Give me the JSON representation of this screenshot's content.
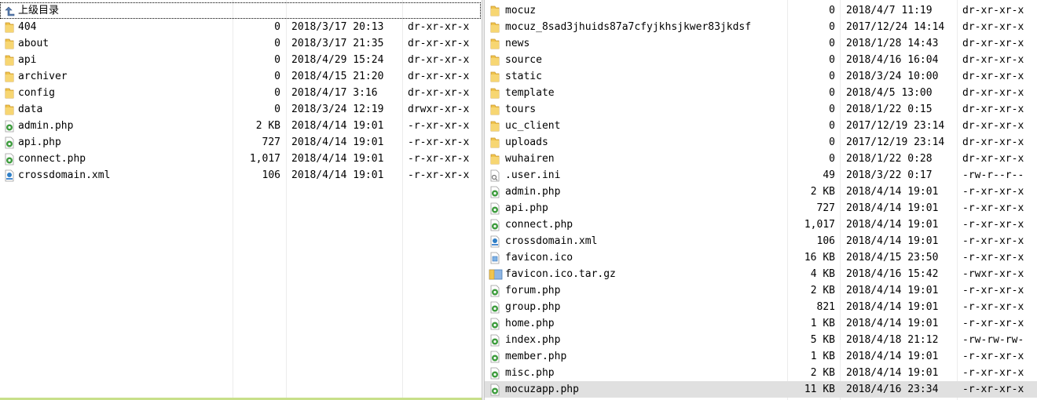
{
  "left_pane": {
    "rows": [
      {
        "name": "上级目录",
        "size": "",
        "date": "",
        "perm": "",
        "icon": "parent-dir-icon",
        "parent": true
      },
      {
        "name": "404",
        "size": "0",
        "date": "2018/3/17 20:13",
        "perm": "dr-xr-xr-x",
        "icon": "folder-icon"
      },
      {
        "name": "about",
        "size": "0",
        "date": "2018/3/17 21:35",
        "perm": "dr-xr-xr-x",
        "icon": "folder-icon"
      },
      {
        "name": "api",
        "size": "0",
        "date": "2018/4/29 15:24",
        "perm": "dr-xr-xr-x",
        "icon": "folder-icon"
      },
      {
        "name": "archiver",
        "size": "0",
        "date": "2018/4/15 21:20",
        "perm": "dr-xr-xr-x",
        "icon": "folder-icon"
      },
      {
        "name": "config",
        "size": "0",
        "date": "2018/4/17 3:16",
        "perm": "dr-xr-xr-x",
        "icon": "folder-icon"
      },
      {
        "name": "data",
        "size": "0",
        "date": "2018/3/24 12:19",
        "perm": "drwxr-xr-x",
        "icon": "folder-icon"
      },
      {
        "name": "admin.php",
        "size": "2 KB",
        "date": "2018/4/14 19:01",
        "perm": "-r-xr-xr-x",
        "icon": "php-file-icon"
      },
      {
        "name": "api.php",
        "size": "727",
        "date": "2018/4/14 19:01",
        "perm": "-r-xr-xr-x",
        "icon": "php-file-icon"
      },
      {
        "name": "connect.php",
        "size": "1,017",
        "date": "2018/4/14 19:01",
        "perm": "-r-xr-xr-x",
        "icon": "php-file-icon"
      },
      {
        "name": "crossdomain.xml",
        "size": "106",
        "date": "2018/4/14 19:01",
        "perm": "-r-xr-xr-x",
        "icon": "xml-file-icon"
      }
    ]
  },
  "right_pane": {
    "rows": [
      {
        "name": "mocuz",
        "size": "0",
        "date": "2018/4/7 11:19",
        "perm": "dr-xr-xr-x",
        "icon": "folder-icon"
      },
      {
        "name": "mocuz_8sad3jhuids87a7cfyjkhsjkwer83jkdsf",
        "size": "0",
        "date": "2017/12/24 14:14",
        "perm": "dr-xr-xr-x",
        "icon": "folder-icon"
      },
      {
        "name": "news",
        "size": "0",
        "date": "2018/1/28 14:43",
        "perm": "dr-xr-xr-x",
        "icon": "folder-icon"
      },
      {
        "name": "source",
        "size": "0",
        "date": "2018/4/16 16:04",
        "perm": "dr-xr-xr-x",
        "icon": "folder-icon"
      },
      {
        "name": "static",
        "size": "0",
        "date": "2018/3/24 10:00",
        "perm": "dr-xr-xr-x",
        "icon": "folder-icon"
      },
      {
        "name": "template",
        "size": "0",
        "date": "2018/4/5 13:00",
        "perm": "dr-xr-xr-x",
        "icon": "folder-icon"
      },
      {
        "name": "tours",
        "size": "0",
        "date": "2018/1/22 0:15",
        "perm": "dr-xr-xr-x",
        "icon": "folder-icon"
      },
      {
        "name": "uc_client",
        "size": "0",
        "date": "2017/12/19 23:14",
        "perm": "dr-xr-xr-x",
        "icon": "folder-icon"
      },
      {
        "name": "uploads",
        "size": "0",
        "date": "2017/12/19 23:14",
        "perm": "dr-xr-xr-x",
        "icon": "folder-icon"
      },
      {
        "name": "wuhairen",
        "size": "0",
        "date": "2018/1/22 0:28",
        "perm": "dr-xr-xr-x",
        "icon": "folder-icon"
      },
      {
        "name": ".user.ini",
        "size": "49",
        "date": "2018/3/22 0:17",
        "perm": "-rw-r--r--",
        "icon": "ini-file-icon"
      },
      {
        "name": "admin.php",
        "size": "2 KB",
        "date": "2018/4/14 19:01",
        "perm": "-r-xr-xr-x",
        "icon": "php-file-icon"
      },
      {
        "name": "api.php",
        "size": "727",
        "date": "2018/4/14 19:01",
        "perm": "-r-xr-xr-x",
        "icon": "php-file-icon"
      },
      {
        "name": "connect.php",
        "size": "1,017",
        "date": "2018/4/14 19:01",
        "perm": "-r-xr-xr-x",
        "icon": "php-file-icon"
      },
      {
        "name": "crossdomain.xml",
        "size": "106",
        "date": "2018/4/14 19:01",
        "perm": "-r-xr-xr-x",
        "icon": "xml-file-icon"
      },
      {
        "name": "favicon.ico",
        "size": "16 KB",
        "date": "2018/4/15 23:50",
        "perm": "-r-xr-xr-x",
        "icon": "image-file-icon"
      },
      {
        "name": "favicon.ico.tar.gz",
        "size": "4 KB",
        "date": "2018/4/16 15:42",
        "perm": "-rwxr-xr-x",
        "icon": "archive-file-icon"
      },
      {
        "name": "forum.php",
        "size": "2 KB",
        "date": "2018/4/14 19:01",
        "perm": "-r-xr-xr-x",
        "icon": "php-file-icon"
      },
      {
        "name": "group.php",
        "size": "821",
        "date": "2018/4/14 19:01",
        "perm": "-r-xr-xr-x",
        "icon": "php-file-icon"
      },
      {
        "name": "home.php",
        "size": "1 KB",
        "date": "2018/4/14 19:01",
        "perm": "-r-xr-xr-x",
        "icon": "php-file-icon"
      },
      {
        "name": "index.php",
        "size": "5 KB",
        "date": "2018/4/18 21:12",
        "perm": "-rw-rw-rw-",
        "icon": "php-file-icon"
      },
      {
        "name": "member.php",
        "size": "1 KB",
        "date": "2018/4/14 19:01",
        "perm": "-r-xr-xr-x",
        "icon": "php-file-icon"
      },
      {
        "name": "misc.php",
        "size": "2 KB",
        "date": "2018/4/14 19:01",
        "perm": "-r-xr-xr-x",
        "icon": "php-file-icon"
      },
      {
        "name": "mocuzapp.php",
        "size": "11 KB",
        "date": "2018/4/16 23:34",
        "perm": "-r-xr-xr-x",
        "icon": "php-file-icon",
        "selected": true
      }
    ]
  }
}
